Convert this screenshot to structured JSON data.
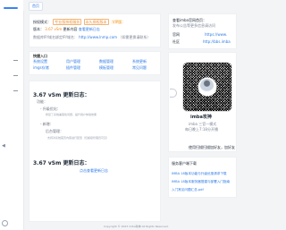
{
  "top": {
    "tab_label": "首页"
  },
  "left_top": {
    "line1_prefix": "授权模式：",
    "line1_badge1": "专业版授权服务",
    "line1_badge2": "永久授权版本",
    "line1_badge3": "VIP版",
    "line2_prefix": "版本：",
    "line2_version": "3.67 vSm",
    "line2_suffix": "更新内容",
    "line2_link": "查看更新日志",
    "line3_prefix": "数据库IP/域名绑定IP/域名：",
    "line3_value": "http://www.lnmp.com",
    "line3_suffix": "（如需更换请联系）"
  },
  "links": {
    "title": "快捷入口",
    "items": [
      "系统设置",
      "用户管理",
      "数据管理",
      "系统更新",
      "imgs存储",
      "插件管理",
      "模板管理",
      "常见问题"
    ]
  },
  "logs": {
    "entry1_title": "3.67 vSm 更新日志：",
    "entry1_label": "功能：",
    "entry1_item1": "- 升级优化：",
    "entry1_item1_desc": "修复了系统兼容性问题，提升用户体验效果",
    "entry1_item2": "- 新增：",
    "entry1_item2_title": "后台管理：",
    "entry1_item2_desc": "支持对系统首页内容进行配置（仅超级管理员可见）",
    "entry2_title": "3.67 vSm 更新日志：",
    "entry2_link": "点击查看更新日志"
  },
  "right_top": {
    "line1": "查看imba官网首页：",
    "line1_sub": "发布公告等更多信息请访问",
    "row1_label": "官网",
    "row1_value": "https://www.",
    "row2_label": "社区",
    "row2_value": "http://bbs.imba"
  },
  "qr": {
    "name": "imba攻神",
    "subtitle": "imba 三官一模式",
    "subtitle2": "每日晚上7:18分开播",
    "scan_hint": "使用扫描扫描加好友，加好友"
  },
  "service": {
    "title": "服务客户端下载",
    "links": [
      "IMBA 18版本功能与升级优惠请求下载",
      "IMBA 18版本服务器搭建与部署入门指南",
      "入门常见问题汇总.pdf"
    ]
  },
  "footer": {
    "text": "Copyright © 2023 imba攻神 All Rights Reserved."
  },
  "colors": {
    "accent": "#2d7be5",
    "highlight": "#f28c28",
    "surface": "#ffffff",
    "background": "#f3f4f6"
  }
}
